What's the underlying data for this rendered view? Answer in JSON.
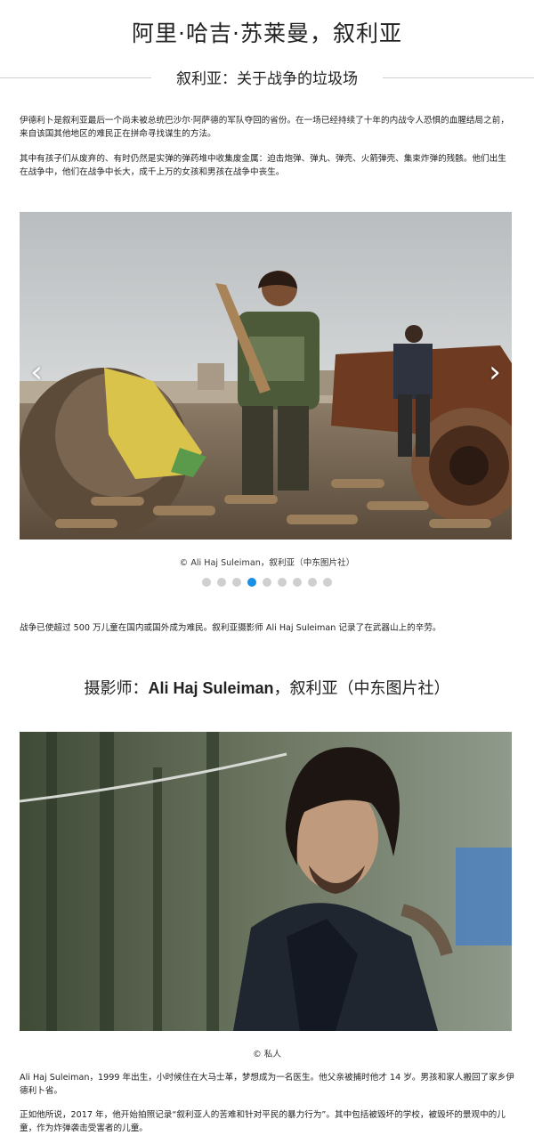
{
  "page": {
    "title": "阿里·哈吉·苏莱曼，叙利亚",
    "subtitle": "叙利亚：关于战争的垃圾场"
  },
  "intro": {
    "p1": "伊德利卜是叙利亚最后一个尚未被总统巴沙尔·阿萨德的军队夺回的省份。在一场已经持续了十年的内战令人恐惧的血腥结局之前，来自该国其他地区的难民正在拼命寻找谋生的方法。",
    "p2": "其中有孩子们从废弃的、有时仍然是实弹的弹药堆中收集废金属：迫击炮弹、弹丸、弹壳、火箭弹壳、集束炸弹的残骸。他们出生在战争中，他们在战争中长大，成千上万的女孩和男孩在战争中丧生。"
  },
  "carousel": {
    "caption": "© Ali Haj Suleiman，叙利亚（中东图片社）",
    "slide_count": 9,
    "active_index": 3,
    "prev_glyph": "‹",
    "next_glyph": "›"
  },
  "body": {
    "p3": "战争已使超过 500 万儿童在国内或国外成为难民。叙利亚摄影师 Ali Haj Suleiman 记录了在武器山上的辛劳。"
  },
  "photographer": {
    "heading_prefix": "摄影师：",
    "heading_name": "Ali Haj Suleiman",
    "heading_suffix": "，叙利亚（中东图片社）",
    "caption": "© 私人",
    "bio1": "Ali Haj Suleiman，1999 年出生，小时候住在大马士革，梦想成为一名医生。他父亲被捕时他才 14 岁。男孩和家人搬回了家乡伊德利卜省。",
    "bio2": "正如他所说，2017 年，他开始拍照记录“叙利亚人的苦难和针对平民的暴力行为”。其中包括被毁坏的学校，被毁坏的景观中的儿童，作为炸弹袭击受害者的儿童。"
  },
  "colors": {
    "accent": "#1a8fe3",
    "dot_inactive": "#cfcfcf",
    "text": "#222222"
  }
}
